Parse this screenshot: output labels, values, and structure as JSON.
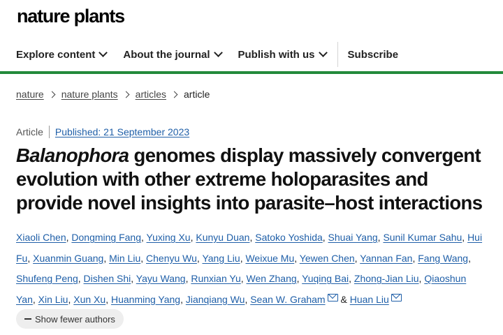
{
  "brand": {
    "logo_text": "nature plants"
  },
  "nav": {
    "items": [
      {
        "label": "Explore content"
      },
      {
        "label": "About the journal"
      },
      {
        "label": "Publish with us"
      }
    ],
    "subscribe_label": "Subscribe"
  },
  "colors": {
    "accent_bar": "#238a3b",
    "link": "#1f5fa8"
  },
  "breadcrumb": {
    "items": [
      "nature",
      "nature plants",
      "articles"
    ],
    "current": "article"
  },
  "article": {
    "type": "Article",
    "published": "Published: 21 September 2023",
    "title_italic": "Balanophora",
    "title_rest": " genomes display massively convergent evolution with other extreme holoparasites and provide novel insights into parasite–host interactions",
    "authors": [
      "Xiaoli Chen",
      "Dongming Fang",
      "Yuxing Xu",
      "Kunyu Duan",
      "Satoko Yoshida",
      "Shuai Yang",
      "Sunil Kumar Sahu",
      "Hui Fu",
      "Xuanmin Guang",
      "Min Liu",
      "Chenyu Wu",
      "Yang Liu",
      "Weixue Mu",
      "Yewen Chen",
      "Yannan Fan",
      "Fang Wang",
      "Shufeng Peng",
      "Dishen Shi",
      "Yayu Wang",
      "Runxian Yu",
      "Wen Zhang",
      "Yuqing Bai",
      "Zhong-Jian Liu",
      "Qiaoshun Yan",
      "Xin Liu",
      "Xun Xu",
      "Huanming Yang",
      "Jianqiang Wu",
      "Sean W. Graham",
      "Huan Liu"
    ],
    "author_conjunction": "&",
    "show_fewer_label": "Show fewer authors"
  }
}
